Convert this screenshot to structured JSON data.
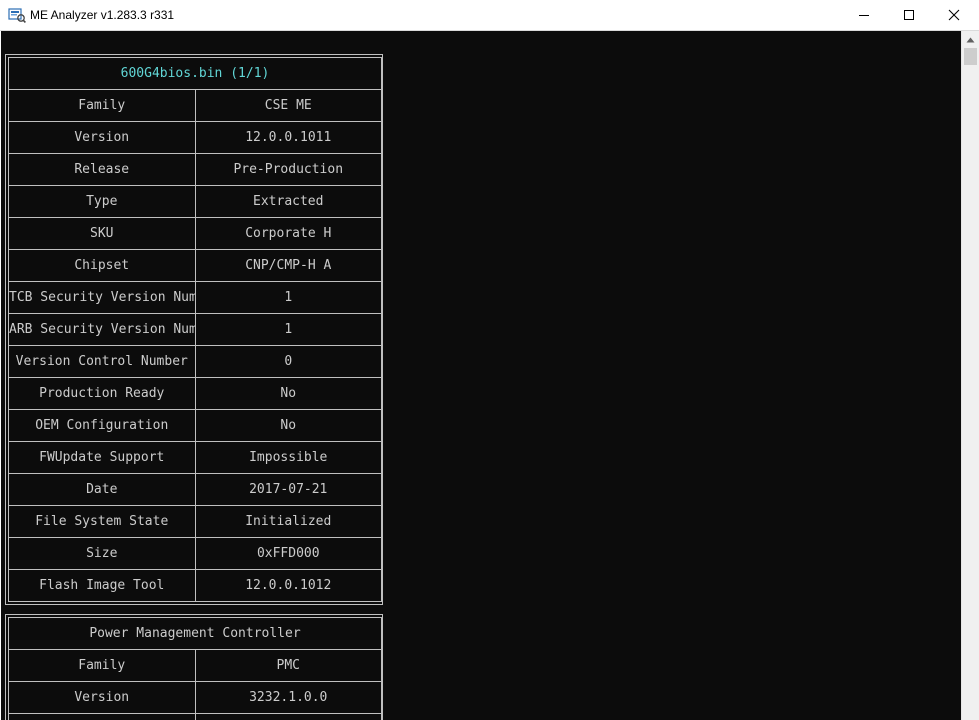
{
  "window": {
    "title": "ME Analyzer v1.283.3 r331",
    "icon": "me-analyzer-app-icon",
    "controls": [
      "minimize-icon",
      "maximize-icon",
      "close-icon"
    ]
  },
  "colors": {
    "console_bg": "#0c0c0c",
    "text": "#cccccc",
    "border": "#c0c0c0",
    "header_accent": "#61d6d6"
  },
  "firmware": {
    "header": "600G4bios.bin (1/1)",
    "rows": [
      {
        "key": "Family",
        "value": "CSE ME"
      },
      {
        "key": "Version",
        "value": "12.0.0.1011"
      },
      {
        "key": "Release",
        "value": "Pre-Production"
      },
      {
        "key": "Type",
        "value": "Extracted"
      },
      {
        "key": "SKU",
        "value": "Corporate H"
      },
      {
        "key": "Chipset",
        "value": "CNP/CMP-H A"
      },
      {
        "key": "TCB Security Version Number",
        "value": "1"
      },
      {
        "key": "ARB Security Version Number",
        "value": "1"
      },
      {
        "key": "Version Control Number",
        "value": "0"
      },
      {
        "key": "Production Ready",
        "value": "No"
      },
      {
        "key": "OEM Configuration",
        "value": "No"
      },
      {
        "key": "FWUpdate Support",
        "value": "Impossible"
      },
      {
        "key": "Date",
        "value": "2017-07-21"
      },
      {
        "key": "File System State",
        "value": "Initialized"
      },
      {
        "key": "Size",
        "value": "0xFFD000"
      },
      {
        "key": "Flash Image Tool",
        "value": "12.0.0.1012"
      }
    ]
  },
  "pmc": {
    "header": "Power Management Controller",
    "rows": [
      {
        "key": "Family",
        "value": "PMC"
      },
      {
        "key": "Version",
        "value": "3232.1.0.0"
      },
      {
        "key": "",
        "value": ""
      }
    ]
  }
}
